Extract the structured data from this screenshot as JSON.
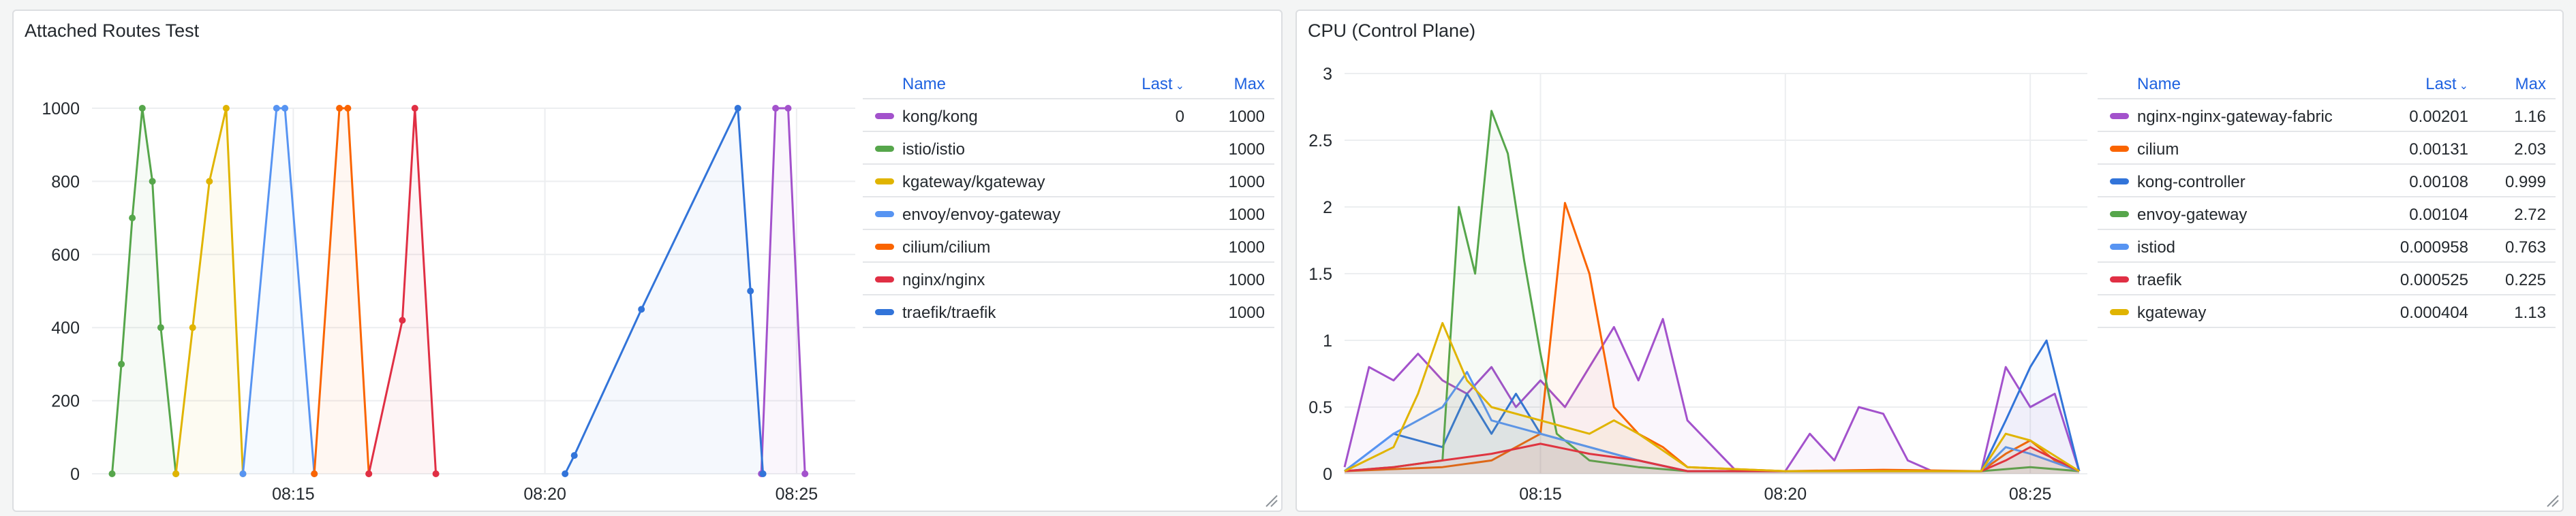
{
  "panels": [
    {
      "title": "Attached Routes Test",
      "legend": {
        "headers": {
          "name": "Name",
          "last": "Last",
          "max": "Max"
        },
        "rows": [
          {
            "name": "kong/kong",
            "color": "#a352cc",
            "last": "0",
            "max": "1000"
          },
          {
            "name": "istio/istio",
            "color": "#56a64b",
            "last": "",
            "max": "1000"
          },
          {
            "name": "kgateway/kgateway",
            "color": "#e0b400",
            "last": "",
            "max": "1000"
          },
          {
            "name": "envoy/envoy-gateway",
            "color": "#5794f2",
            "last": "",
            "max": "1000"
          },
          {
            "name": "cilium/cilium",
            "color": "#fa6400",
            "last": "",
            "max": "1000"
          },
          {
            "name": "nginx/nginx",
            "color": "#e02f44",
            "last": "",
            "max": "1000"
          },
          {
            "name": "traefik/traefik",
            "color": "#3274d9",
            "last": "",
            "max": "1000"
          }
        ]
      }
    },
    {
      "title": "CPU (Control Plane)",
      "legend": {
        "headers": {
          "name": "Name",
          "last": "Last",
          "max": "Max"
        },
        "rows": [
          {
            "name": "nginx-nginx-gateway-fabric",
            "color": "#a352cc",
            "last": "0.00201",
            "max": "1.16"
          },
          {
            "name": "cilium",
            "color": "#fa6400",
            "last": "0.00131",
            "max": "2.03"
          },
          {
            "name": "kong-controller",
            "color": "#3274d9",
            "last": "0.00108",
            "max": "0.999"
          },
          {
            "name": "envoy-gateway",
            "color": "#56a64b",
            "last": "0.00104",
            "max": "2.72"
          },
          {
            "name": "istiod",
            "color": "#5794f2",
            "last": "0.000958",
            "max": "0.763"
          },
          {
            "name": "traefik",
            "color": "#e02f44",
            "last": "0.000525",
            "max": "0.225"
          },
          {
            "name": "kgateway",
            "color": "#e0b400",
            "last": "0.000404",
            "max": "1.13"
          }
        ]
      }
    }
  ],
  "chart_data": [
    {
      "type": "line",
      "title": "Attached Routes Test",
      "x_unit": "clock time (HH:MM)",
      "xlim": [
        "08:11:00",
        "08:26:10"
      ],
      "ylim": [
        0,
        1000
      ],
      "yticks": [
        0,
        200,
        400,
        600,
        800,
        1000
      ],
      "xticks": [
        "08:15",
        "08:20",
        "08:25"
      ],
      "grid": true,
      "legend_placement": "right",
      "series": [
        {
          "name": "kong/kong",
          "color": "#a352cc",
          "x": [
            "08:24:18",
            "08:24:35",
            "08:24:50",
            "08:25:10"
          ],
          "y": [
            0,
            1000,
            1000,
            0
          ]
        },
        {
          "name": "istio/istio",
          "color": "#56a64b",
          "x": [
            "08:11:24",
            "08:11:35",
            "08:11:48",
            "08:12:00",
            "08:12:12",
            "08:12:22",
            "08:12:40"
          ],
          "y": [
            0,
            300,
            700,
            1000,
            800,
            400,
            0
          ]
        },
        {
          "name": "kgateway/kgateway",
          "color": "#e0b400",
          "x": [
            "08:12:40",
            "08:13:00",
            "08:13:20",
            "08:13:40",
            "08:14:00"
          ],
          "y": [
            0,
            400,
            800,
            1000,
            0
          ]
        },
        {
          "name": "envoy/envoy-gateway",
          "color": "#5794f2",
          "x": [
            "08:14:00",
            "08:14:40",
            "08:14:50",
            "08:15:25"
          ],
          "y": [
            0,
            1000,
            1000,
            0
          ]
        },
        {
          "name": "cilium/cilium",
          "color": "#fa6400",
          "x": [
            "08:15:25",
            "08:15:55",
            "08:16:05",
            "08:16:30"
          ],
          "y": [
            0,
            1000,
            1000,
            0
          ]
        },
        {
          "name": "nginx/nginx",
          "color": "#e02f44",
          "x": [
            "08:16:30",
            "08:17:10",
            "08:17:25",
            "08:17:50"
          ],
          "y": [
            0,
            420,
            1000,
            0
          ]
        },
        {
          "name": "traefik/traefik",
          "color": "#3274d9",
          "x": [
            "08:20:24",
            "08:20:35",
            "08:21:55",
            "08:23:50",
            "08:24:05",
            "08:24:20"
          ],
          "y": [
            0,
            50,
            450,
            1000,
            500,
            0
          ]
        }
      ]
    },
    {
      "type": "line",
      "title": "CPU (Control Plane)",
      "x_unit": "clock time (HH:MM)",
      "xlim": [
        "08:11:00",
        "08:26:10"
      ],
      "ylim": [
        0,
        3
      ],
      "yticks": [
        0,
        0.5,
        1,
        1.5,
        2,
        2.5,
        3
      ],
      "yticklabels": [
        "0",
        "0.5",
        "1",
        "1.5",
        "2",
        "2.5",
        "3"
      ],
      "xticks": [
        "08:15",
        "08:20",
        "08:25"
      ],
      "grid": true,
      "legend_placement": "right",
      "series": [
        {
          "name": "nginx-nginx-gateway-fabric",
          "color": "#a352cc",
          "x": [
            "08:11:00",
            "08:11:30",
            "08:12:00",
            "08:12:30",
            "08:13:00",
            "08:13:30",
            "08:14:00",
            "08:14:30",
            "08:15:00",
            "08:15:30",
            "08:16:00",
            "08:16:30",
            "08:17:00",
            "08:17:30",
            "08:18:00",
            "08:19:00",
            "08:20:00",
            "08:20:30",
            "08:21:00",
            "08:21:30",
            "08:22:00",
            "08:22:30",
            "08:23:00",
            "08:24:00",
            "08:24:30",
            "08:25:00",
            "08:25:30",
            "08:26:00"
          ],
          "y": [
            0.05,
            0.8,
            0.7,
            0.9,
            0.7,
            0.6,
            0.8,
            0.5,
            0.7,
            0.5,
            0.8,
            1.1,
            0.7,
            1.16,
            0.4,
            0.02,
            0.02,
            0.3,
            0.1,
            0.5,
            0.45,
            0.1,
            0.02,
            0.02,
            0.8,
            0.5,
            0.6,
            0.02
          ]
        },
        {
          "name": "cilium",
          "color": "#fa6400",
          "x": [
            "08:11:00",
            "08:13:00",
            "08:14:00",
            "08:15:00",
            "08:15:30",
            "08:16:00",
            "08:16:30",
            "08:17:00",
            "08:17:30",
            "08:18:00",
            "08:20:00",
            "08:22:00",
            "08:24:00",
            "08:24:30",
            "08:25:00",
            "08:25:30",
            "08:26:00"
          ],
          "y": [
            0.02,
            0.05,
            0.1,
            0.3,
            2.03,
            1.5,
            0.5,
            0.3,
            0.2,
            0.05,
            0.02,
            0.03,
            0.02,
            0.15,
            0.25,
            0.1,
            0.02
          ]
        },
        {
          "name": "kong-controller",
          "color": "#3274d9",
          "x": [
            "08:11:00",
            "08:12:00",
            "08:13:00",
            "08:13:30",
            "08:14:00",
            "08:14:30",
            "08:15:00",
            "08:16:00",
            "08:17:00",
            "08:18:00",
            "08:20:00",
            "08:22:00",
            "08:24:00",
            "08:24:30",
            "08:25:00",
            "08:25:20",
            "08:26:00"
          ],
          "y": [
            0.02,
            0.3,
            0.2,
            0.6,
            0.3,
            0.6,
            0.3,
            0.2,
            0.1,
            0.02,
            0.02,
            0.02,
            0.02,
            0.4,
            0.8,
            0.999,
            0.02
          ]
        },
        {
          "name": "envoy-gateway",
          "color": "#56a64b",
          "x": [
            "08:11:00",
            "08:12:00",
            "08:13:00",
            "08:13:20",
            "08:13:40",
            "08:14:00",
            "08:14:20",
            "08:14:40",
            "08:15:00",
            "08:15:20",
            "08:16:00",
            "08:17:00",
            "08:18:00",
            "08:20:00",
            "08:22:00",
            "08:24:00",
            "08:25:00",
            "08:26:00"
          ],
          "y": [
            0.02,
            0.05,
            0.1,
            2.0,
            1.5,
            2.72,
            2.4,
            1.6,
            0.9,
            0.3,
            0.1,
            0.05,
            0.02,
            0.02,
            0.02,
            0.02,
            0.05,
            0.02
          ]
        },
        {
          "name": "istiod",
          "color": "#5794f2",
          "x": [
            "08:11:00",
            "08:12:00",
            "08:13:00",
            "08:13:30",
            "08:14:00",
            "08:15:00",
            "08:16:00",
            "08:17:00",
            "08:18:00",
            "08:20:00",
            "08:22:00",
            "08:24:00",
            "08:24:30",
            "08:25:00",
            "08:26:00"
          ],
          "y": [
            0.02,
            0.3,
            0.5,
            0.763,
            0.4,
            0.3,
            0.2,
            0.1,
            0.02,
            0.02,
            0.02,
            0.02,
            0.2,
            0.15,
            0.02
          ]
        },
        {
          "name": "traefik",
          "color": "#e02f44",
          "x": [
            "08:11:00",
            "08:12:00",
            "08:13:00",
            "08:14:00",
            "08:15:00",
            "08:16:00",
            "08:17:00",
            "08:18:00",
            "08:20:00",
            "08:22:00",
            "08:24:00",
            "08:24:30",
            "08:25:00",
            "08:26:00"
          ],
          "y": [
            0.02,
            0.05,
            0.1,
            0.15,
            0.225,
            0.15,
            0.1,
            0.02,
            0.02,
            0.02,
            0.02,
            0.1,
            0.2,
            0.02
          ]
        },
        {
          "name": "kgateway",
          "color": "#e0b400",
          "x": [
            "08:11:00",
            "08:12:00",
            "08:12:30",
            "08:13:00",
            "08:13:30",
            "08:14:00",
            "08:15:00",
            "08:16:00",
            "08:16:30",
            "08:17:00",
            "08:18:00",
            "08:20:00",
            "08:22:00",
            "08:24:00",
            "08:24:30",
            "08:25:00",
            "08:26:00"
          ],
          "y": [
            0.02,
            0.2,
            0.6,
            1.13,
            0.7,
            0.5,
            0.4,
            0.3,
            0.4,
            0.3,
            0.05,
            0.02,
            0.02,
            0.02,
            0.3,
            0.25,
            0.02
          ]
        }
      ]
    }
  ]
}
